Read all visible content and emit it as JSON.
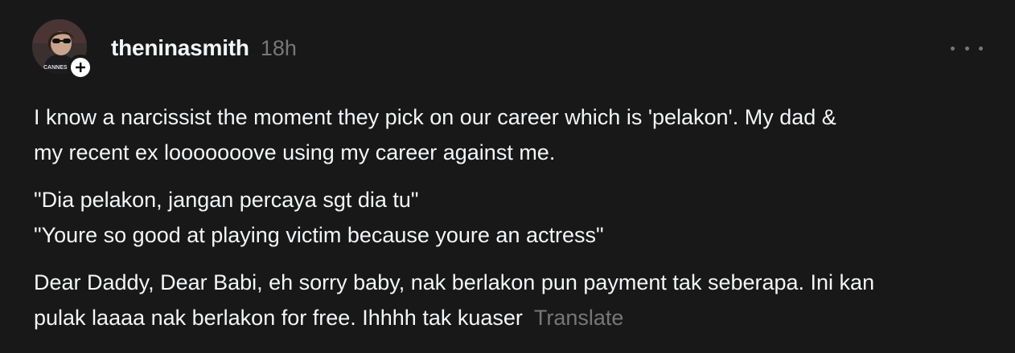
{
  "post": {
    "username": "theninasmith",
    "timestamp": "18h",
    "avatar_icon": "profile-photo",
    "follow_icon": "plus-icon",
    "more_icon": "more-horizontal-icon",
    "paragraphs": [
      {
        "lines": [
          "I know a narcissist the moment they pick on our career which is 'pelakon'. My dad &",
          "my recent ex looooooove using my career against me."
        ]
      },
      {
        "lines": [
          "\"Dia pelakon, jangan percaya sgt dia tu\"",
          "\"Youre so good at playing victim because youre an actress\""
        ]
      },
      {
        "lines": [
          "Dear Daddy, Dear Babi, eh sorry baby, nak berlakon pun payment tak seberapa. Ini kan",
          "pulak laaaa nak berlakon for free. Ihhhh tak kuaser"
        ]
      }
    ],
    "translate_label": "Translate"
  },
  "colors": {
    "background": "#181818",
    "primary_text": "#f3f5f7",
    "secondary_text": "#777777"
  }
}
